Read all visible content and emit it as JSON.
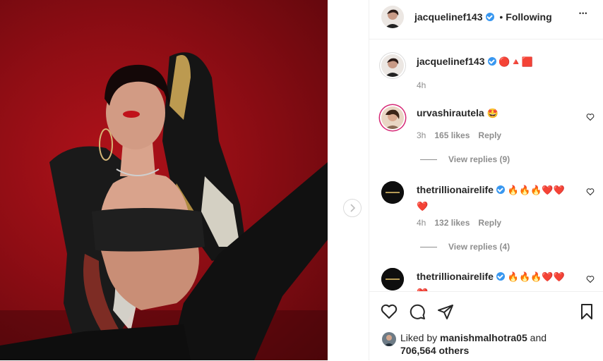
{
  "post": {
    "author": "jacquelinef143",
    "follow_separator": "•",
    "follow_status": "Following",
    "more_label": "•••"
  },
  "caption": {
    "username": "jacquelinef143",
    "text": "🔴🔺🟥",
    "time": "4h"
  },
  "comments": [
    {
      "username": "urvashirautela",
      "text": "🤩",
      "time": "3h",
      "likes": "165 likes",
      "reply_label": "Reply",
      "view_replies": "View replies (9)"
    },
    {
      "username": "thetrillionairelife",
      "text": "🔥🔥🔥❤️❤️",
      "text2": "❤️",
      "time": "4h",
      "likes": "132 likes",
      "reply_label": "Reply",
      "view_replies": "View replies (4)"
    },
    {
      "username": "thetrillionairelife",
      "text": "🔥🔥🔥❤️❤️",
      "text2": "❤️"
    }
  ],
  "likes_summary": {
    "prefix": "Liked by",
    "user": "manishmalhotra05",
    "suffix": "and",
    "count": "706,564 others"
  },
  "colors": {
    "accent": "#3897f0",
    "muted": "#8e8e8e",
    "border": "#efefef",
    "photo_bg": "#9b0f17"
  }
}
